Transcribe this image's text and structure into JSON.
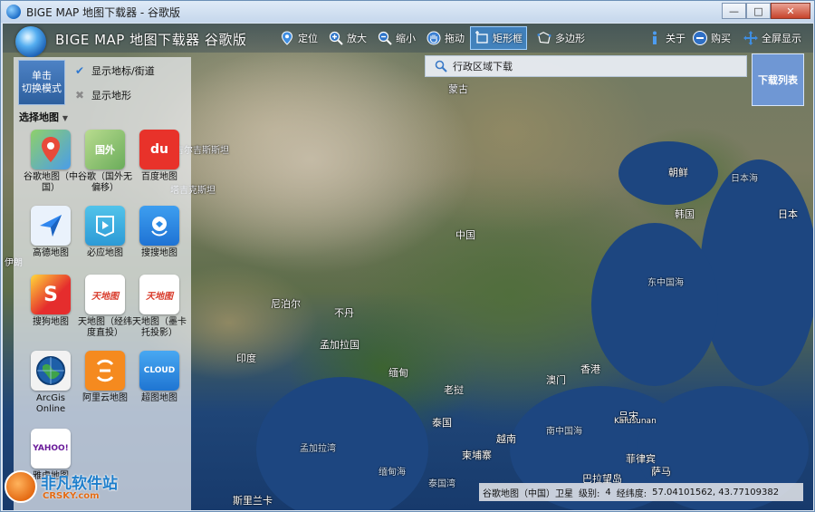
{
  "window": {
    "title": "BIGE MAP 地图下载器 - 谷歌版",
    "controls": {
      "minimize": "—",
      "maximize": "□",
      "close": "✕"
    }
  },
  "toolbar": {
    "app_name": "BIGE MAP 地图下载器 谷歌版",
    "tools": [
      {
        "label": "定位",
        "icon": "location-pin-icon"
      },
      {
        "label": "放大",
        "icon": "zoom-in-icon"
      },
      {
        "label": "缩小",
        "icon": "zoom-out-icon"
      },
      {
        "label": "拖动",
        "icon": "hand-drag-icon"
      },
      {
        "label": "矩形框",
        "icon": "rectangle-select-icon",
        "active": true
      },
      {
        "label": "多边形",
        "icon": "polygon-icon"
      },
      {
        "label": "关于",
        "icon": "info-icon"
      },
      {
        "label": "购买",
        "icon": "cart-icon"
      },
      {
        "label": "全屏显示",
        "icon": "fullscreen-icon"
      }
    ]
  },
  "search": {
    "label": "行政区域下载"
  },
  "download_list": {
    "label": "下载列表"
  },
  "panel": {
    "switch_mode": {
      "line1": "单击",
      "line2": "切换模式"
    },
    "select_map": "选择地图",
    "options": [
      {
        "label": "显示地标/街道",
        "checked": true
      },
      {
        "label": "显示地形",
        "checked": false
      }
    ],
    "maps": [
      {
        "label": "谷歌地图（中国）",
        "tile_text": "",
        "color": "#5aa5e8"
      },
      {
        "label": "谷歌（国外无偏移）",
        "tile_text": "国外",
        "color": "#6aac5a"
      },
      {
        "label": "百度地图",
        "tile_text": "du",
        "color": "#e8322a"
      },
      {
        "label": "高德地图",
        "tile_text": "",
        "color": "#3a8cf0"
      },
      {
        "label": "必应地图",
        "tile_text": "",
        "color": "#39b0e0"
      },
      {
        "label": "搜搜地图",
        "tile_text": "",
        "color": "#2a8ae6"
      },
      {
        "label": "搜狗地图",
        "tile_text": "S",
        "color": "#e52d2d"
      },
      {
        "label": "天地图（经纬度直投）",
        "tile_text": "天地图",
        "color": "#ffffff"
      },
      {
        "label": "天地图（墨卡托投影）",
        "tile_text": "天地图",
        "color": "#ffffff"
      },
      {
        "label": "ArcGis Online",
        "tile_text": "",
        "color": "#2f7d3a"
      },
      {
        "label": "阿里云地图",
        "tile_text": "",
        "color": "#f58a1f"
      },
      {
        "label": "超图地图",
        "tile_text": "CLOUD",
        "color": "#2b8be0"
      },
      {
        "label": "雅虎地图",
        "tile_text": "YAHOO!",
        "color": "#ffffff"
      }
    ]
  },
  "map_labels": [
    {
      "text": "蒙古",
      "kind": "land"
    },
    {
      "text": "中国",
      "kind": "land"
    },
    {
      "text": "朝鲜",
      "kind": "land"
    },
    {
      "text": "日本海",
      "kind": "sea"
    },
    {
      "text": "韩国",
      "kind": "land"
    },
    {
      "text": "日本",
      "kind": "land"
    },
    {
      "text": "东中国海",
      "kind": "sea"
    },
    {
      "text": "尼泊尔",
      "kind": "land"
    },
    {
      "text": "不丹",
      "kind": "land"
    },
    {
      "text": "孟加拉国",
      "kind": "land"
    },
    {
      "text": "印度",
      "kind": "land"
    },
    {
      "text": "缅甸",
      "kind": "land"
    },
    {
      "text": "老挝",
      "kind": "land"
    },
    {
      "text": "澳门",
      "kind": "land"
    },
    {
      "text": "香港",
      "kind": "land"
    },
    {
      "text": "泰国",
      "kind": "land"
    },
    {
      "text": "越南",
      "kind": "land"
    },
    {
      "text": "南中国海",
      "kind": "sea"
    },
    {
      "text": "吕宋",
      "kind": "land"
    },
    {
      "text": "Kalusunan",
      "kind": "land"
    },
    {
      "text": "柬埔寨",
      "kind": "land"
    },
    {
      "text": "菲律宾",
      "kind": "land"
    },
    {
      "text": "孟加拉湾",
      "kind": "sea"
    },
    {
      "text": "缅甸海",
      "kind": "sea"
    },
    {
      "text": "泰国湾",
      "kind": "sea"
    },
    {
      "text": "巴拉望岛",
      "kind": "land"
    },
    {
      "text": "萨马",
      "kind": "land"
    },
    {
      "text": "斯里兰卡",
      "kind": "land"
    },
    {
      "text": "吉尔吉斯斯坦",
      "kind": "land"
    },
    {
      "text": "塔吉克斯坦",
      "kind": "land"
    },
    {
      "text": "伊朗",
      "kind": "land"
    }
  ],
  "status": {
    "source": "谷歌地图（中国）卫星",
    "level_label": "级别:",
    "level": "4",
    "coord_label": "经纬度:",
    "coords": "57.04101562, 43.77109382"
  },
  "watermark": {
    "name": "非凡软件站",
    "site": "CRSKY.com"
  }
}
